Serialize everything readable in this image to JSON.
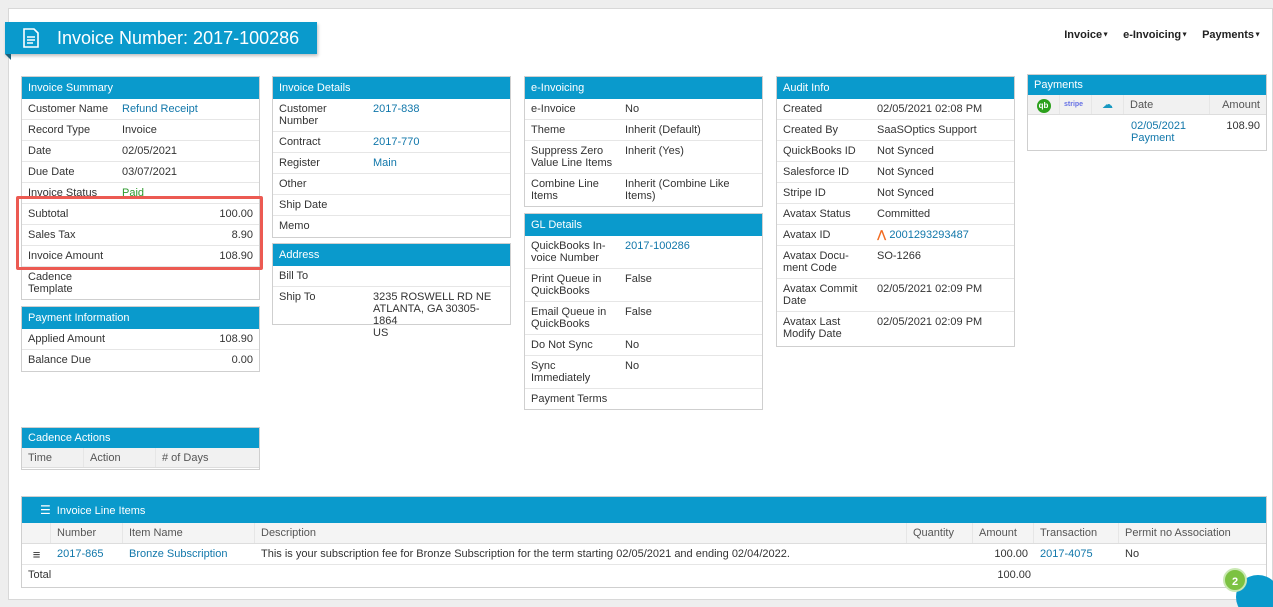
{
  "header": {
    "title": "Invoice Number: 2017-100286",
    "nav": [
      "Invoice",
      "e-Invoicing",
      "Payments"
    ]
  },
  "invoice_summary": {
    "title": "Invoice Summary",
    "rows": [
      {
        "label": "Customer Name",
        "value": "Refund Receipt"
      },
      {
        "label": "Record Type",
        "value": "Invoice"
      },
      {
        "label": "Date",
        "value": "02/05/2021"
      },
      {
        "label": "Due Date",
        "value": "03/07/2021"
      },
      {
        "label": "Invoice Status",
        "value": "Paid"
      },
      {
        "label": "Subtotal",
        "value": "100.00"
      },
      {
        "label": "Sales Tax",
        "value": "8.90"
      },
      {
        "label": "Invoice Amount",
        "value": "108.90"
      },
      {
        "label": "Cadence Template",
        "value": ""
      }
    ]
  },
  "payment_information": {
    "title": "Payment Information",
    "rows": [
      {
        "label": "Applied Amount",
        "value": "108.90"
      },
      {
        "label": "Balance Due",
        "value": "0.00"
      }
    ]
  },
  "cadence_actions": {
    "title": "Cadence Actions",
    "columns": [
      "Time",
      "Action",
      "# of Days"
    ]
  },
  "invoice_details": {
    "title": "Invoice Details",
    "rows": [
      {
        "label": "Customer Number",
        "value": "2017-838"
      },
      {
        "label": "Contract",
        "value": "2017-770"
      },
      {
        "label": "Register",
        "value": "Main"
      },
      {
        "label": "Other",
        "value": ""
      },
      {
        "label": "Ship Date",
        "value": ""
      },
      {
        "label": "Memo",
        "value": ""
      }
    ]
  },
  "address": {
    "title": "Address",
    "bill_to_label": "Bill To",
    "ship_to_label": "Ship To",
    "ship_to_line1": "3235 ROSWELL RD NE",
    "ship_to_line2": "ATLANTA, GA 30305-1864",
    "ship_to_line3": "US"
  },
  "e_invoicing": {
    "title": "e-Invoicing",
    "rows": [
      {
        "label": "e-Invoice",
        "value": "No"
      },
      {
        "label": "Theme",
        "value": "Inherit (Default)"
      },
      {
        "label": "Suppress Zero Value Line Items",
        "value": "Inherit (Yes)"
      },
      {
        "label": "Combine Line Items",
        "value": "Inherit (Combine Like Items)"
      }
    ]
  },
  "gl_details": {
    "title": "GL Details",
    "rows": [
      {
        "label": "QuickBooks In-voice Number",
        "value": "2017-100286"
      },
      {
        "label": "Print Queue in QuickBooks",
        "value": "False"
      },
      {
        "label": "Email Queue in QuickBooks",
        "value": "False"
      },
      {
        "label": "Do Not Sync",
        "value": "No"
      },
      {
        "label": "Sync Immediately",
        "value": "No"
      },
      {
        "label": "Payment Terms",
        "value": ""
      }
    ]
  },
  "audit_info": {
    "title": "Audit Info",
    "rows": [
      {
        "label": "Created",
        "value": "02/05/2021 02:08 PM"
      },
      {
        "label": "Created By",
        "value": "SaaSOptics Support"
      },
      {
        "label": "QuickBooks ID",
        "value": "Not Synced"
      },
      {
        "label": "Salesforce ID",
        "value": "Not Synced"
      },
      {
        "label": "Stripe ID",
        "value": "Not Synced"
      },
      {
        "label": "Avatax Status",
        "value": "Committed"
      },
      {
        "label": "Avatax ID",
        "value": "2001293293487"
      },
      {
        "label": "Avatax Docu-ment Code",
        "value": "SO-1266"
      },
      {
        "label": "Avatax Commit Date",
        "value": "02/05/2021 02:09 PM"
      },
      {
        "label": "Avatax Last Modify Date",
        "value": "02/05/2021 02:09 PM"
      }
    ]
  },
  "payments": {
    "title": "Payments",
    "stripe_label": "stripe",
    "columns": [
      "Date",
      "Amount"
    ],
    "rows": [
      {
        "date": "02/05/2021",
        "type": "Payment",
        "amount": "108.90"
      }
    ]
  },
  "line_items": {
    "title": "Invoice Line Items",
    "columns": [
      "Number",
      "Item Name",
      "Description",
      "Quantity",
      "Amount",
      "Transaction",
      "Permit no Association"
    ],
    "rows": [
      {
        "number": "2017-865",
        "item_name": "Bronze Subscription",
        "description": "This is your subscription fee for Bronze Subscription for the term starting 02/05/2021 and ending 02/04/2022.",
        "quantity": "",
        "amount": "100.00",
        "transaction": "2017-4075",
        "permit": "No"
      }
    ],
    "total_label": "Total",
    "total_amount": "100.00"
  },
  "notifications": {
    "count": "2"
  }
}
